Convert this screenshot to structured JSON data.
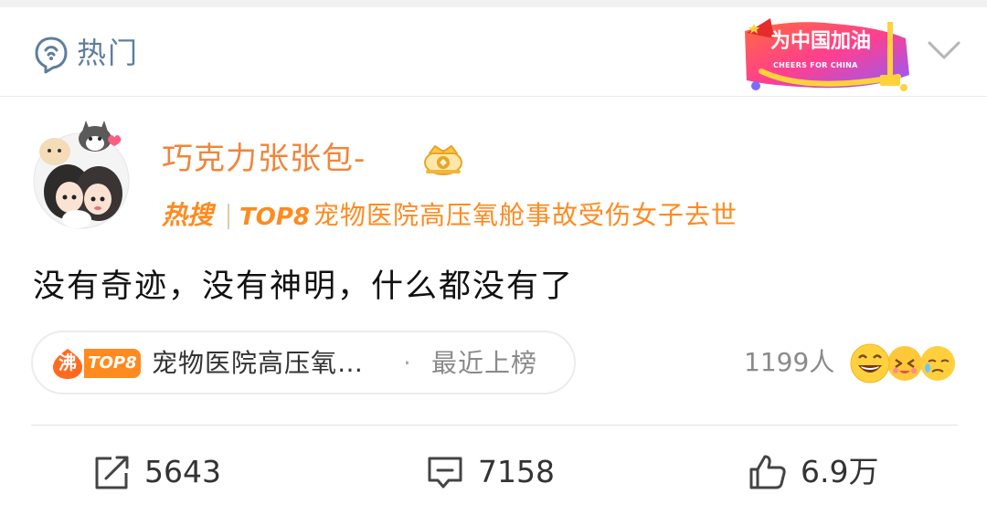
{
  "header": {
    "title": "热门",
    "title_icon": "hot-topic-icon",
    "banner": {
      "title": "为中国加油",
      "subtitle": "CHEERS FOR CHINA"
    },
    "expand_icon": "chevron-down-icon"
  },
  "post": {
    "username": "巧克力张张包-",
    "badge_icon": "crown-icon",
    "hot_search": {
      "label": "热搜",
      "rank": "TOP8",
      "title": "宠物医院高压氧舱事故受伤女子去世"
    },
    "text": "没有奇迹，没有神明，什么都没有了",
    "topic_pill": {
      "icon_text": "沸",
      "rank": "TOP8",
      "title": "宠物医院高压氧…",
      "separator": "·",
      "status": "最近上榜"
    },
    "reactions": {
      "count": "1199人",
      "icons": [
        "laughing-emoji-icon",
        "kissing-emoji-icon",
        "sad-emoji-icon"
      ]
    },
    "actions": {
      "repost_count": "5643",
      "comment_count": "7158",
      "like_count": "6.9万"
    }
  },
  "colors": {
    "accent_orange": "#ff8a1f",
    "username_orange": "#f3843a",
    "header_blue": "#5d7e9e",
    "muted_gray": "#8a8a8a"
  }
}
